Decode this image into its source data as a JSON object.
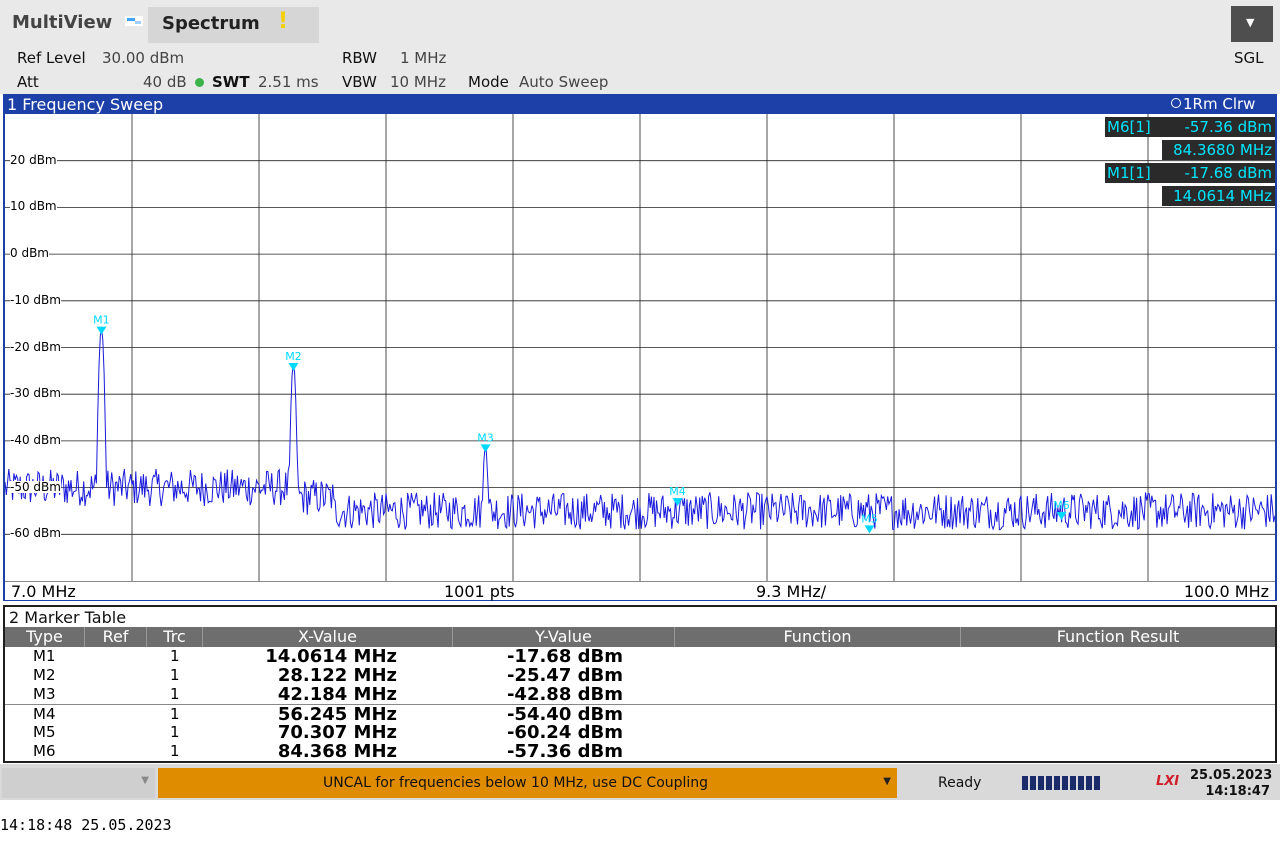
{
  "header": {
    "app_title": "MultiView",
    "tab_label": "Spectrum",
    "tab_warning": "!",
    "sgl": "SGL",
    "settings": {
      "ref_level_label": "Ref Level",
      "ref_level_value": "30.00 dBm",
      "att_label": "Att",
      "att_value": "40 dB",
      "swt_label": "SWT",
      "swt_value": "2.51 ms",
      "rbw_label": "RBW",
      "rbw_value": "1 MHz",
      "vbw_label": "VBW",
      "vbw_value": "10 MHz",
      "mode_label": "Mode",
      "mode_value": "Auto Sweep"
    }
  },
  "window1": {
    "title": "1 Frequency Sweep",
    "trace_indicator": "1Rm Clrw",
    "marker_info": [
      {
        "name": "M6[1]",
        "level": "-57.36 dBm",
        "freq": "84.3680 MHz"
      },
      {
        "name": "M1[1]",
        "level": "-17.68 dBm",
        "freq": "14.0614 MHz"
      }
    ],
    "y_labels": [
      "20 dBm",
      "10 dBm",
      "0 dBm",
      "-10 dBm",
      "-20 dBm",
      "-30 dBm",
      "-40 dBm",
      "-50 dBm",
      "-60 dBm"
    ],
    "x_start": "7.0 MHz",
    "points": "1001 pts",
    "span_per_div": "9.3 MHz/",
    "x_stop": "100.0 MHz"
  },
  "chart_data": {
    "type": "line",
    "title": "1 Frequency Sweep",
    "xlabel": "",
    "ylabel": "",
    "xlim": [
      7.0,
      100.0
    ],
    "ylim": [
      -70,
      30
    ],
    "grid": true,
    "y_ticks": [
      20,
      10,
      0,
      -10,
      -20,
      -30,
      -40,
      -50,
      -60
    ],
    "noise_floor_dbm": -55,
    "peaks": [
      {
        "freq": 14.06,
        "level": -17.68
      },
      {
        "freq": 28.12,
        "level": -25.47
      },
      {
        "freq": 42.18,
        "level": -42.88
      }
    ],
    "markers": [
      {
        "name": "M1",
        "freq": 14.0614,
        "level": -17.68
      },
      {
        "name": "M2",
        "freq": 28.122,
        "level": -25.47
      },
      {
        "name": "M3",
        "freq": 42.184,
        "level": -42.88
      },
      {
        "name": "M4",
        "freq": 56.245,
        "level": -54.4
      },
      {
        "name": "M5",
        "freq": 70.307,
        "level": -60.24
      },
      {
        "name": "M6",
        "freq": 84.368,
        "level": -57.36
      }
    ],
    "trace_color": "#1a1adc",
    "marker_color": "#00d8ff"
  },
  "window2": {
    "title": "2 Marker Table",
    "columns": [
      "Type",
      "Ref",
      "Trc",
      "X-Value",
      "Y-Value",
      "Function",
      "Function Result"
    ],
    "rows": [
      {
        "type": "M1",
        "ref": "",
        "trc": "1",
        "x": "14.0614 MHz",
        "y": "-17.68 dBm"
      },
      {
        "type": "M2",
        "ref": "",
        "trc": "1",
        "x": "28.122 MHz",
        "y": "-25.47 dBm"
      },
      {
        "type": "M3",
        "ref": "",
        "trc": "1",
        "x": "42.184 MHz",
        "y": "-42.88 dBm"
      },
      {
        "type": "M4",
        "ref": "",
        "trc": "1",
        "x": "56.245 MHz",
        "y": "-54.40 dBm"
      },
      {
        "type": "M5",
        "ref": "",
        "trc": "1",
        "x": "70.307 MHz",
        "y": "-60.24 dBm"
      },
      {
        "type": "M6",
        "ref": "",
        "trc": "1",
        "x": "84.368 MHz",
        "y": "-57.36 dBm"
      }
    ]
  },
  "status": {
    "message": "UNCAL for frequencies below 10 MHz, use DC Coupling",
    "state": "Ready",
    "date": "25.05.2023",
    "time": "14:18:47",
    "lxi": "LXI"
  },
  "footer": {
    "stamp": "14:18:48  25.05.2023"
  },
  "colors": {
    "window_blue": "#1c3fa8",
    "status_orange": "#e08c00",
    "marker_cyan": "#00e5ff"
  }
}
